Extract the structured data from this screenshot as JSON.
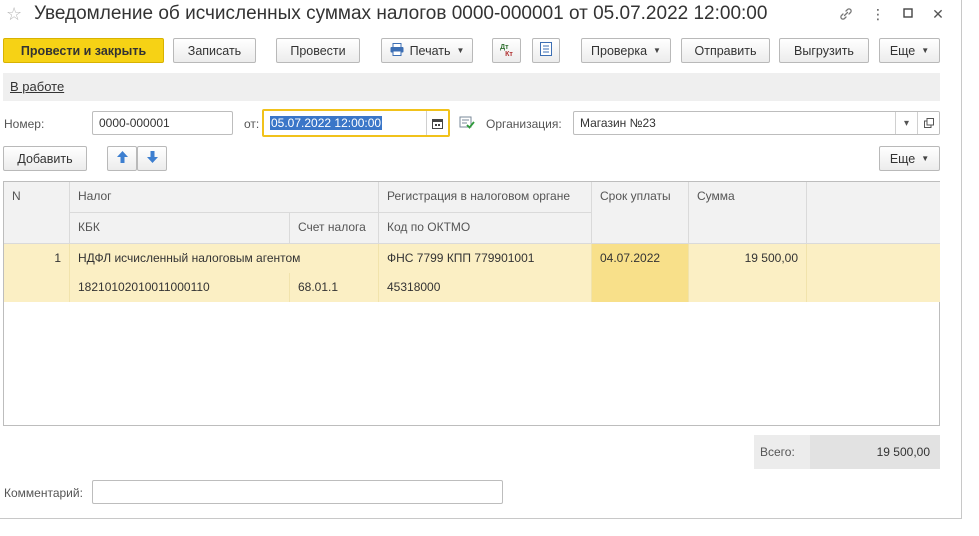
{
  "window": {
    "title": "Уведомление об исчисленных суммах налогов 0000-000001 от 05.07.2022 12:00:00"
  },
  "toolbar": {
    "post_close": "Провести и закрыть",
    "save": "Записать",
    "post": "Провести",
    "print": "Печать",
    "dt_kt": "Дт Кт",
    "check": "Проверка",
    "send": "Отправить",
    "export": "Выгрузить",
    "more": "Еще"
  },
  "status": {
    "label": "В работе"
  },
  "header": {
    "number_label": "Номер:",
    "number_value": "0000-000001",
    "date_label": "от:",
    "date_value": "05.07.2022 12:00:00",
    "org_label": "Организация:",
    "org_value": "Магазин №23"
  },
  "table_toolbar": {
    "add": "Добавить",
    "more": "Еще"
  },
  "table": {
    "headers": {
      "n": "N",
      "tax": "Налог",
      "kbk": "КБК",
      "account": "Счет налога",
      "registration": "Регистрация в налоговом органе",
      "oktmo": "Код по ОКТМО",
      "due_date": "Срок уплаты",
      "amount": "Сумма"
    },
    "rows": [
      {
        "n": "1",
        "tax": "НДФЛ исчисленный налоговым агентом",
        "kbk": "18210102010011000110",
        "account": "68.01.1",
        "registration": "ФНС 7799 КПП 779901001",
        "oktmo": "45318000",
        "due_date": "04.07.2022",
        "amount": "19 500,00"
      }
    ]
  },
  "total": {
    "label": "Всего:",
    "value": "19 500,00"
  },
  "comment": {
    "label": "Комментарий:",
    "value": ""
  }
}
